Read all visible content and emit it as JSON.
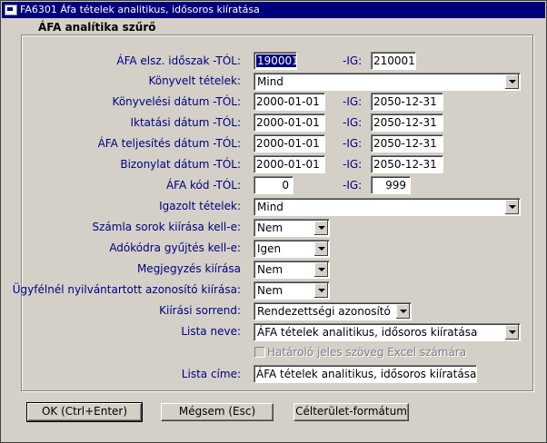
{
  "window": {
    "title": "FA6301 Áfa tételek analitikus, idősoros kiíratása"
  },
  "group": {
    "title": "ÁFA analítika szűrő"
  },
  "rows": {
    "period": {
      "label": "ÁFA elsz. időszak -TÓL:",
      "from": "190001",
      "ig_label": "-IG:",
      "to": "210001"
    },
    "booked": {
      "label": "Könyvelt tételek:",
      "value": "Mind"
    },
    "booking_date": {
      "label": "Könyvelési dátum -TÓL:",
      "from": "2000-01-01",
      "ig_label": "-IG:",
      "to": "2050-12-31"
    },
    "filing_date": {
      "label": "Iktatási dátum -TÓL:",
      "from": "2000-01-01",
      "ig_label": "-IG:",
      "to": "2050-12-31"
    },
    "vat_perf_date": {
      "label": "ÁFA teljesítés dátum -TÓL:",
      "from": "2000-01-01",
      "ig_label": "-IG:",
      "to": "2050-12-31"
    },
    "doc_date": {
      "label": "Bizonylat dátum -TÓL:",
      "from": "2000-01-01",
      "ig_label": "-IG:",
      "to": "2050-12-31"
    },
    "vat_code": {
      "label": "ÁFA kód -TÓL:",
      "from": "0",
      "ig_label": "-IG:",
      "to": "999"
    },
    "verified": {
      "label": "Igazolt tételek:",
      "value": "Mind"
    },
    "invoice_lines": {
      "label": "Számla sorok kiírása kell-e:",
      "value": "Nem"
    },
    "taxcode_collect": {
      "label": "Adókódra gyűjtés kell-e:",
      "value": "Igen"
    },
    "comment_print": {
      "label": "Megjegyzés kiírása",
      "value": "Nem"
    },
    "client_id_print": {
      "label": "Ügyfélnél nyilvántartott azonosító kiírása:",
      "value": "Nem"
    },
    "sort_order": {
      "label": "Kiírási sorrend:",
      "value": "Rendezettségi azonosító"
    },
    "list_name": {
      "label": "Lista neve:",
      "value": "ÁFA tételek analitikus, idősoros kiíratása"
    },
    "excel_checkbox": {
      "label": "Határoló jeles szöveg  Excel számára",
      "checked": false
    },
    "list_title": {
      "label": "Lista címe:",
      "value": "ÁFA tételek analitikus, idősoros kiíratása"
    }
  },
  "buttons": {
    "ok": "OK (Ctrl+Enter)",
    "cancel": "Mégsem (Esc)",
    "target_format": "Célterület-formátum"
  },
  "colors": {
    "titlebar": "#00007b",
    "label": "#000080",
    "face": "#d4d0c8"
  }
}
